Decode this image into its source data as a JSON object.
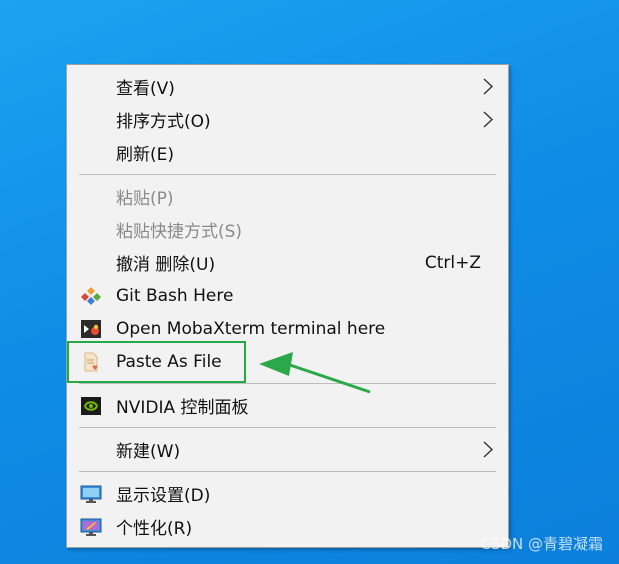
{
  "menu": {
    "view": {
      "label": "查看(V)"
    },
    "sort": {
      "label": "排序方式(O)"
    },
    "refresh": {
      "label": "刷新(E)"
    },
    "paste": {
      "label": "粘贴(P)"
    },
    "paste_shortcut": {
      "label": "粘贴快捷方式(S)"
    },
    "undo_delete": {
      "label": "撤消 删除(U)",
      "shortcut": "Ctrl+Z"
    },
    "git_bash": {
      "label": "Git Bash Here"
    },
    "mobaxterm": {
      "label": "Open MobaXterm terminal here"
    },
    "paste_as_file": {
      "label": "Paste As File"
    },
    "nvidia": {
      "label": "NVIDIA 控制面板"
    },
    "new": {
      "label": "新建(W)"
    },
    "display": {
      "label": "显示设置(D)"
    },
    "personalize": {
      "label": "个性化(R)"
    }
  },
  "watermark": "CSDN @青碧凝霜",
  "colors": {
    "desktop": "#1196e8",
    "menu_bg": "#f2f2f2",
    "highlight": "#26a844",
    "disabled_text": "#8a8a8a"
  },
  "icons": {
    "git_bash": "git-diamond-icon",
    "mobaxterm": "mobaxterm-icon",
    "paste_as_file": "paste-as-file-icon",
    "nvidia": "nvidia-icon",
    "display": "monitor-icon",
    "personalize": "personalize-icon"
  }
}
